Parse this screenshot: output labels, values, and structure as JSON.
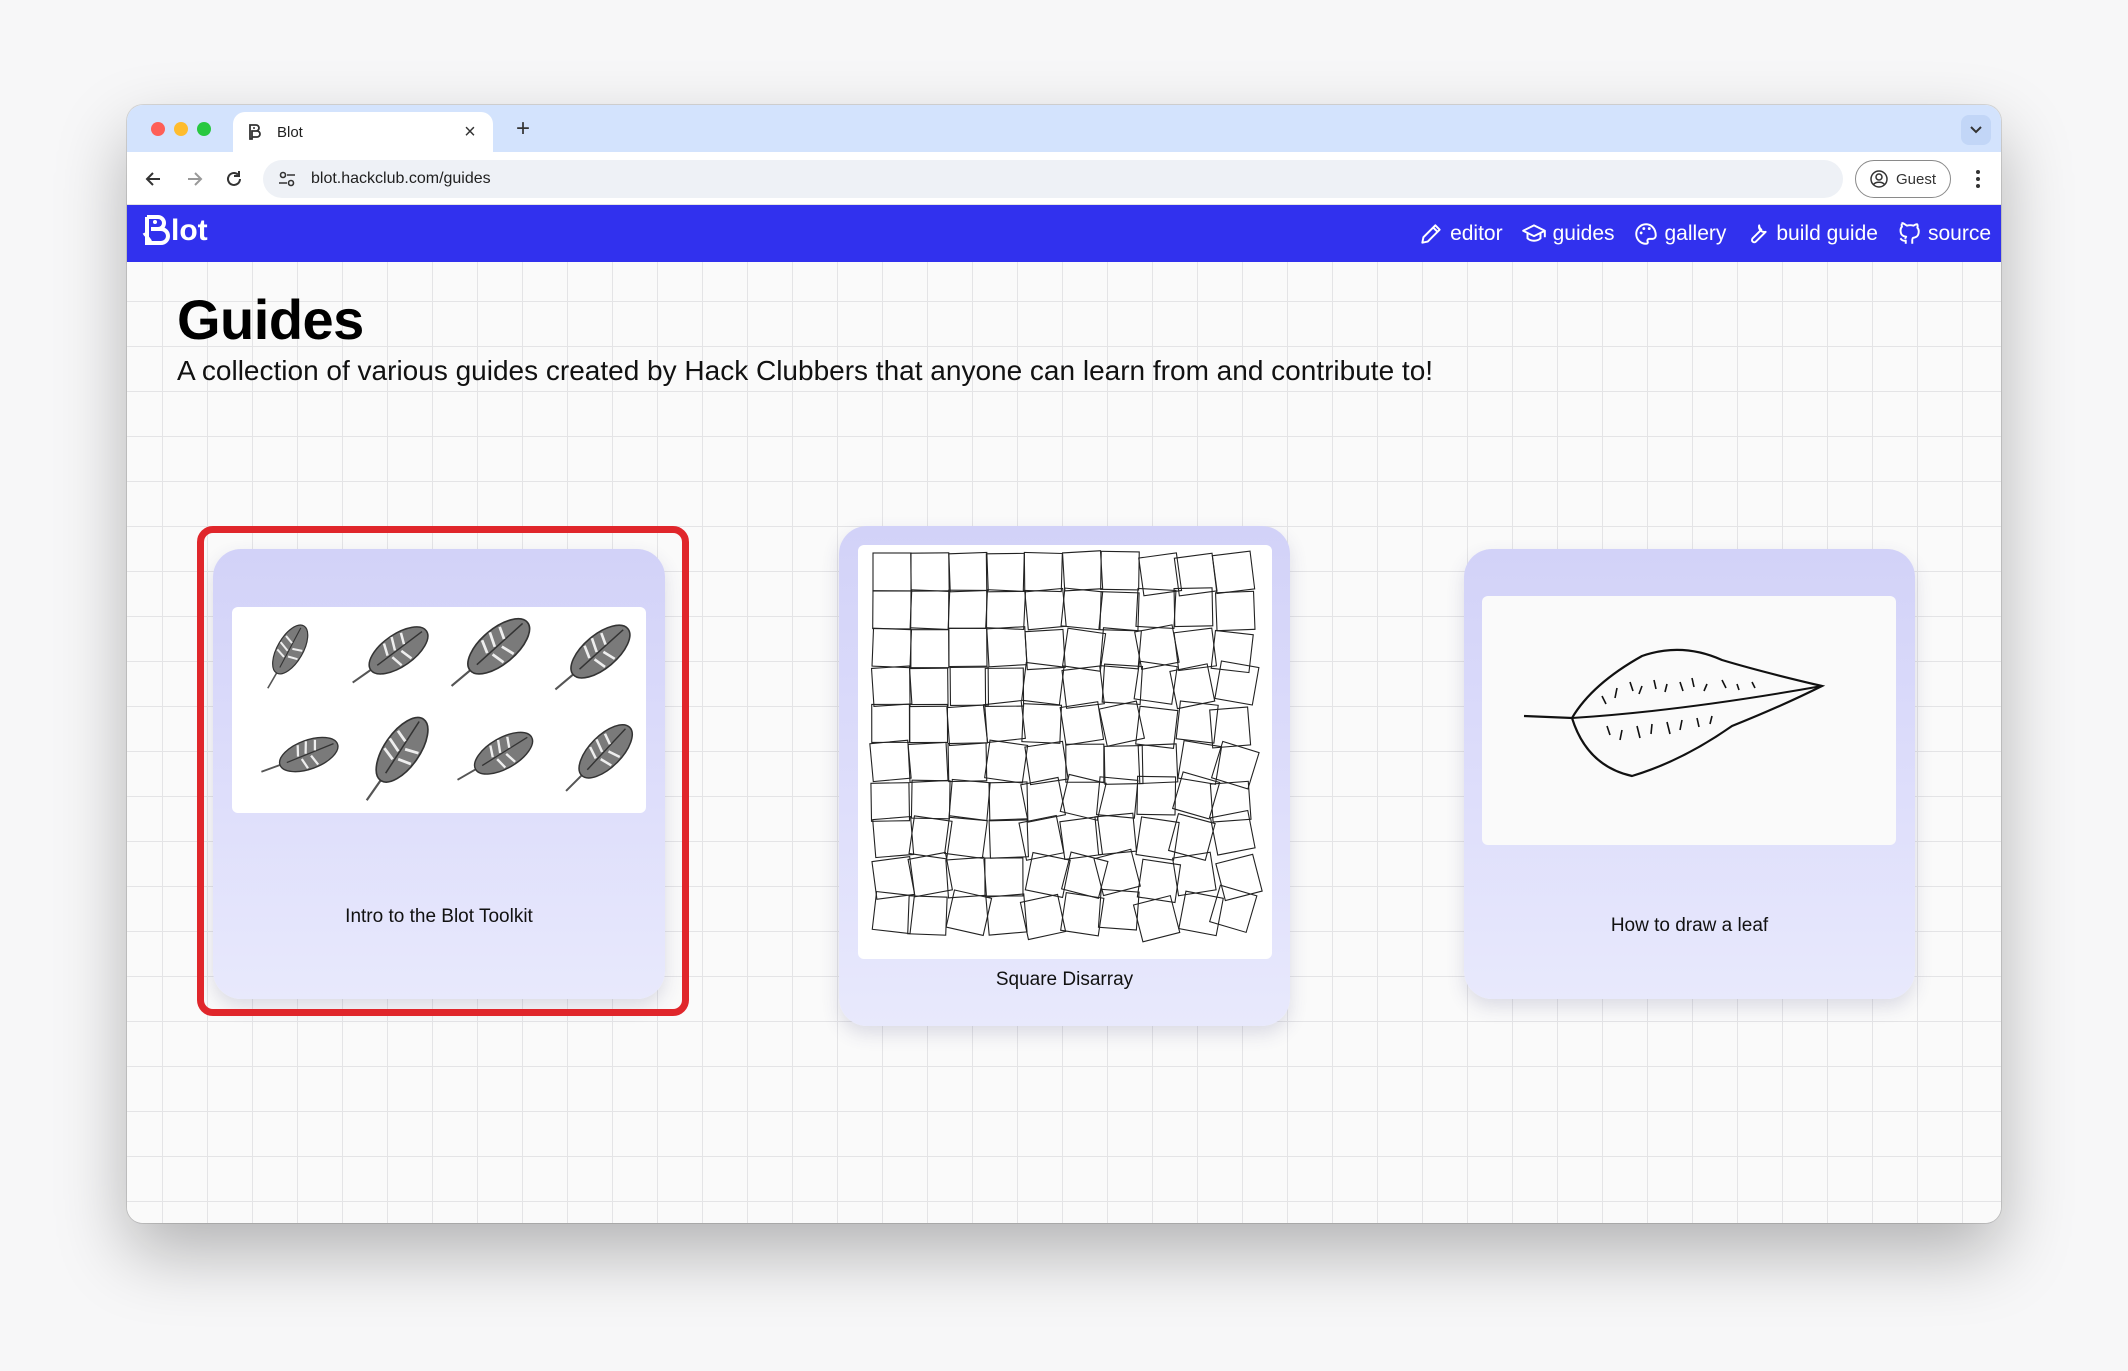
{
  "browser": {
    "tab_title": "Blot",
    "tab_close": "×",
    "new_tab": "+",
    "url": "blot.hackclub.com/guides",
    "profile_label": "Guest"
  },
  "site": {
    "logo_text": "lot",
    "nav": [
      {
        "label": "editor",
        "icon": "pencil-icon"
      },
      {
        "label": "guides",
        "icon": "graduation-cap-icon"
      },
      {
        "label": "gallery",
        "icon": "palette-icon"
      },
      {
        "label": "build guide",
        "icon": "wrench-icon"
      },
      {
        "label": "source",
        "icon": "github-icon"
      }
    ],
    "accent": "#3131ee"
  },
  "content": {
    "title": "Guides",
    "description": "A collection of various guides created by Hack Clubbers that anyone can learn from and contribute to!",
    "cards": [
      {
        "caption": "Intro to the Blot Toolkit",
        "highlighted": true
      },
      {
        "caption": "Square Disarray",
        "highlighted": false
      },
      {
        "caption": "How to draw a leaf",
        "highlighted": false
      }
    ]
  },
  "colors": {
    "highlight": "#e0262b",
    "tabbar": "#d3e3fd"
  }
}
